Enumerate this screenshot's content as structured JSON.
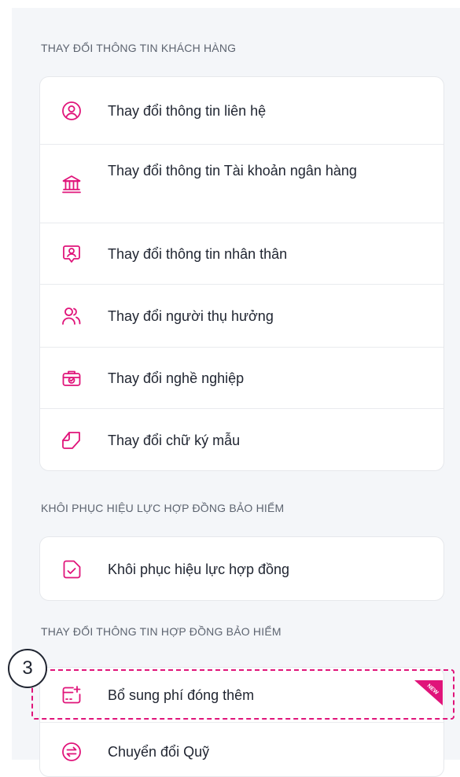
{
  "colors": {
    "accent": "#e0147a",
    "background": "#f4f6f9",
    "card": "#ffffff"
  },
  "sections": [
    {
      "title": "THAY ĐỔI THÔNG TIN KHÁCH HÀNG",
      "items": [
        {
          "label": "Thay đổi thông tin liên hệ",
          "icon": "user-circle-icon"
        },
        {
          "label": "Thay đổi thông tin Tài khoản ngân hàng",
          "icon": "bank-icon"
        },
        {
          "label": "Thay đổi thông tin nhân thân",
          "icon": "id-badge-icon"
        },
        {
          "label": "Thay đổi người thụ hưởng",
          "icon": "users-icon"
        },
        {
          "label": "Thay đổi nghề nghiệp",
          "icon": "briefcase-icon"
        },
        {
          "label": "Thay đổi chữ ký mẫu",
          "icon": "signature-icon"
        }
      ]
    },
    {
      "title": "KHÔI PHỤC HIỆU LỰC HỢP ĐỒNG BẢO HIỂM",
      "items": [
        {
          "label": "Khôi phục hiệu lực hợp đồng",
          "icon": "document-check-icon"
        }
      ]
    },
    {
      "title": "THAY ĐỔI THÔNG TIN HỢP ĐỒNG BẢO HIỂM",
      "items": [
        {
          "label": "Bổ sung phí đóng thêm",
          "icon": "add-payment-icon",
          "badge": "NEW"
        },
        {
          "label": "Chuyển đổi Quỹ",
          "icon": "fund-switch-icon"
        }
      ]
    }
  ],
  "annotation": {
    "step": "3"
  }
}
